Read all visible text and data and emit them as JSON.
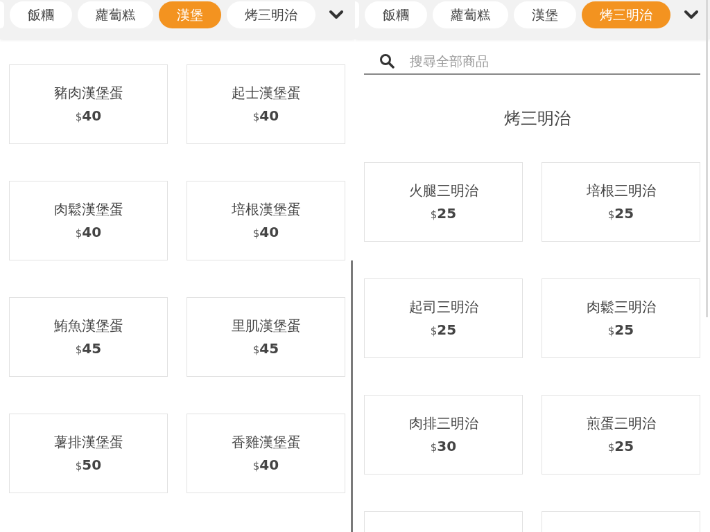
{
  "panels": [
    {
      "categories": [
        {
          "label": "飯糰",
          "selected": false
        },
        {
          "label": "蘿蔔糕",
          "selected": false
        },
        {
          "label": "漢堡",
          "selected": true
        },
        {
          "label": "烤三明治",
          "selected": false
        }
      ],
      "products": [
        {
          "name": "豬肉漢堡蛋",
          "price": "$**40**"
        },
        {
          "name": "起士漢堡蛋",
          "price": "$**40**"
        },
        {
          "name": "肉鬆漢堡蛋",
          "price": "$**40**"
        },
        {
          "name": "培根漢堡蛋",
          "price": "$**40**"
        },
        {
          "name": "鮪魚漢堡蛋",
          "price": "$**45**"
        },
        {
          "name": "里肌漢堡蛋",
          "price": "$**45**"
        },
        {
          "name": "薯排漢堡蛋",
          "price": "$**50**"
        },
        {
          "name": "香雞漢堡蛋",
          "price": "$**40**"
        }
      ]
    },
    {
      "categories": [
        {
          "label": "飯糰",
          "selected": false
        },
        {
          "label": "蘿蔔糕",
          "selected": false
        },
        {
          "label": "漢堡",
          "selected": false
        },
        {
          "label": "烤三明治",
          "selected": true
        }
      ],
      "search": {
        "placeholder": "搜尋全部商品"
      },
      "heading": "烤三明治",
      "products": [
        {
          "name": "火腿三明治",
          "price": "$**25**"
        },
        {
          "name": "培根三明治",
          "price": "$**25**"
        },
        {
          "name": "起司三明治",
          "price": "$**25**"
        },
        {
          "name": "肉鬆三明治",
          "price": "$**25**"
        },
        {
          "name": "肉排三明治",
          "price": "$**30**"
        },
        {
          "name": "煎蛋三明治",
          "price": "$**25**"
        }
      ],
      "more_below": true
    }
  ]
}
